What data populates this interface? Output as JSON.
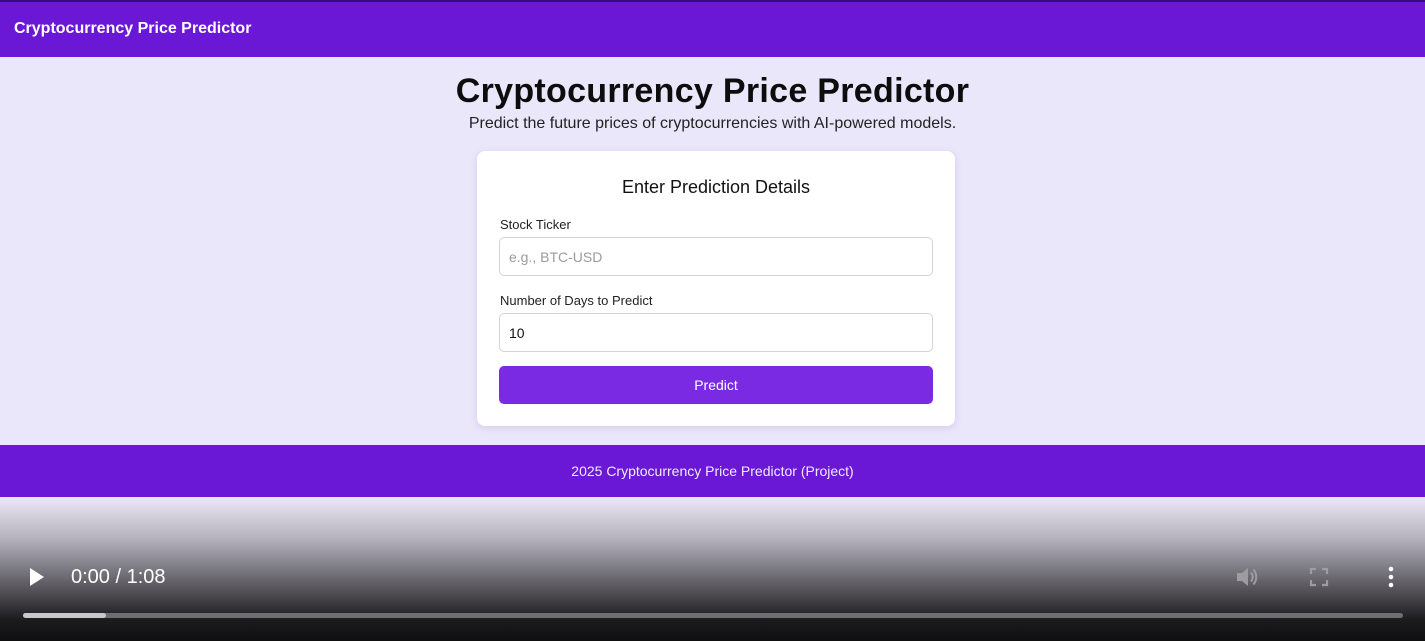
{
  "navbar": {
    "brand": "Cryptocurrency Price Predictor"
  },
  "hero": {
    "title": "Cryptocurrency Price Predictor",
    "subtitle": "Predict the future prices of cryptocurrencies with AI-powered models."
  },
  "form": {
    "title": "Enter Prediction Details",
    "ticker": {
      "label": "Stock Ticker",
      "placeholder": "e.g., BTC-USD",
      "value": ""
    },
    "days": {
      "label": "Number of Days to Predict",
      "value": "10"
    },
    "submit_label": "Predict"
  },
  "footer": {
    "text": "2025 Cryptocurrency Price Predictor (Project)"
  },
  "video_controls": {
    "time_display": "0:00 / 1:08",
    "progress_fraction": 0.06,
    "icons": [
      "play-icon",
      "volume-icon",
      "fullscreen-icon",
      "more-options-icon"
    ]
  },
  "colors": {
    "brand_purple": "#6a17d6",
    "button_purple": "#7a2ae3",
    "page_background": "#ebe7fb"
  }
}
